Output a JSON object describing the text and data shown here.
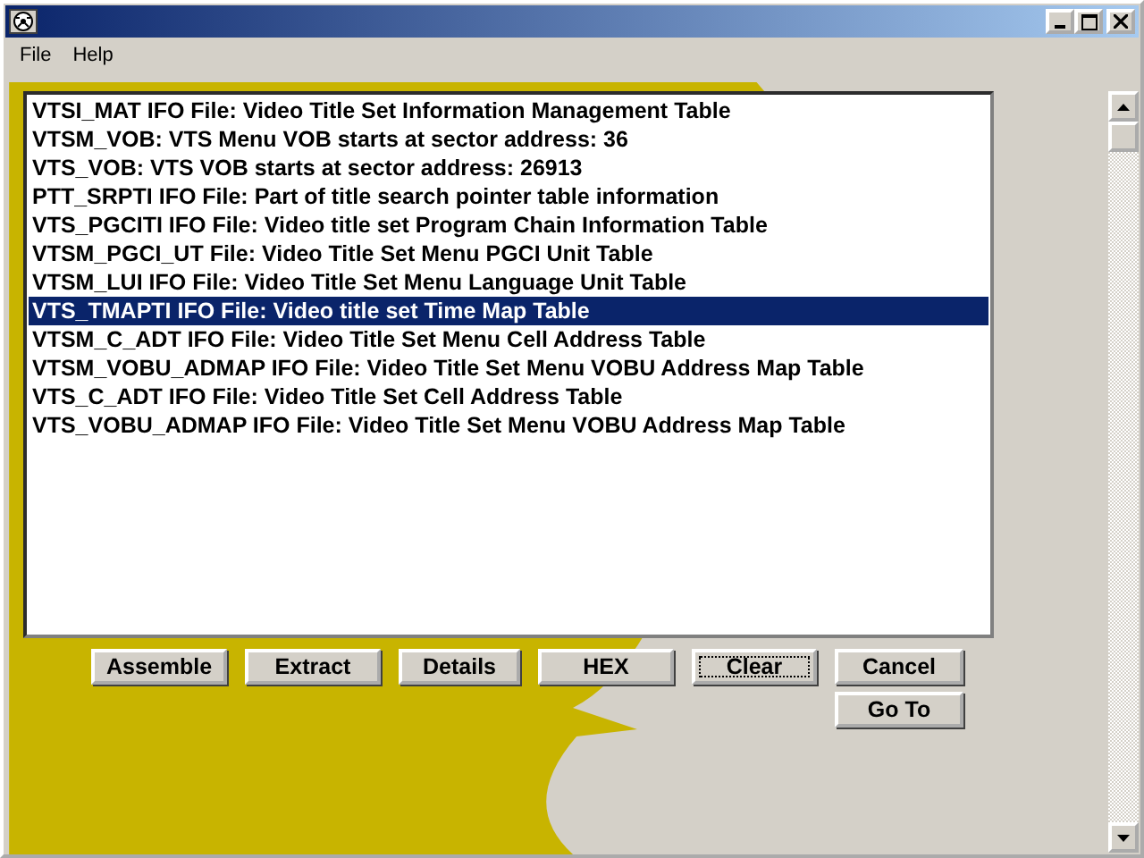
{
  "menu": [
    {
      "label": "File"
    },
    {
      "label": "Help"
    }
  ],
  "list": [
    {
      "text": "VTSI_MAT IFO File: Video Title Set Information Management Table",
      "selected": false
    },
    {
      "text": "VTSM_VOB: VTS Menu VOB starts at sector address: 36",
      "selected": false
    },
    {
      "text": "VTS_VOB: VTS VOB starts at sector address: 26913",
      "selected": false
    },
    {
      "text": "PTT_SRPTI IFO File: Part of title search pointer table information",
      "selected": false
    },
    {
      "text": "VTS_PGCITI IFO File: Video title set Program Chain Information Table",
      "selected": false
    },
    {
      "text": "VTSM_PGCI_UT File: Video Title Set Menu PGCI Unit Table",
      "selected": false
    },
    {
      "text": "VTSM_LUI IFO File: Video Title Set Menu Language Unit Table",
      "selected": false
    },
    {
      "text": "VTS_TMAPTI IFO File: Video title set Time Map Table",
      "selected": true
    },
    {
      "text": "VTSM_C_ADT IFO File: Video Title Set Menu Cell Address Table",
      "selected": false
    },
    {
      "text": "VTSM_VOBU_ADMAP IFO File: Video Title Set Menu VOBU Address Map Table",
      "selected": false
    },
    {
      "text": "VTS_C_ADT IFO File: Video Title Set Cell Address Table",
      "selected": false
    },
    {
      "text": "VTS_VOBU_ADMAP IFO File: Video Title Set Menu VOBU Address Map Table",
      "selected": false
    }
  ],
  "buttons": [
    {
      "label": "Assemble",
      "focused": false
    },
    {
      "label": "Extract",
      "focused": false
    },
    {
      "label": "Details",
      "focused": false
    },
    {
      "label": "HEX",
      "focused": false
    },
    {
      "label": "Clear",
      "focused": true
    },
    {
      "label": "Cancel",
      "focused": false
    },
    {
      "label": "Go To",
      "focused": false
    }
  ]
}
